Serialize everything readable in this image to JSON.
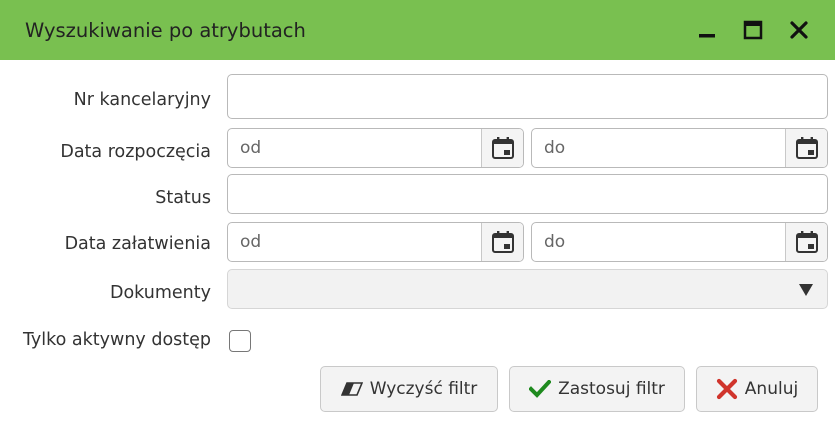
{
  "dialog": {
    "title": "Wyszukiwanie po atrybutach",
    "controls": {
      "minimize_icon": "minimize-icon",
      "maximize_icon": "maximize-icon",
      "close_icon": "close-icon"
    }
  },
  "form": {
    "nr_kancelaryjny": {
      "label": "Nr kancelaryjny",
      "value": ""
    },
    "data_rozpoczecia": {
      "label": "Data rozpoczęcia",
      "from_placeholder": "od",
      "to_placeholder": "do"
    },
    "status": {
      "label": "Status",
      "value": ""
    },
    "data_zalatwienia": {
      "label": "Data załatwienia",
      "from_placeholder": "od",
      "to_placeholder": "do"
    },
    "dokumenty": {
      "label": "Dokumenty",
      "selected": ""
    },
    "tylko_aktywny": {
      "label": "Tylko aktywny dostęp",
      "checked": false
    }
  },
  "buttons": {
    "clear": {
      "label": "Wyczyść filtr",
      "icon": "eraser-icon"
    },
    "apply": {
      "label": "Zastosuj filtr",
      "icon": "checkmark-icon",
      "icon_color": "#1e8a1e"
    },
    "cancel": {
      "label": "Anuluj",
      "icon": "x-icon",
      "icon_color": "#d0342c"
    }
  },
  "colors": {
    "titlebar": "#79c050"
  }
}
